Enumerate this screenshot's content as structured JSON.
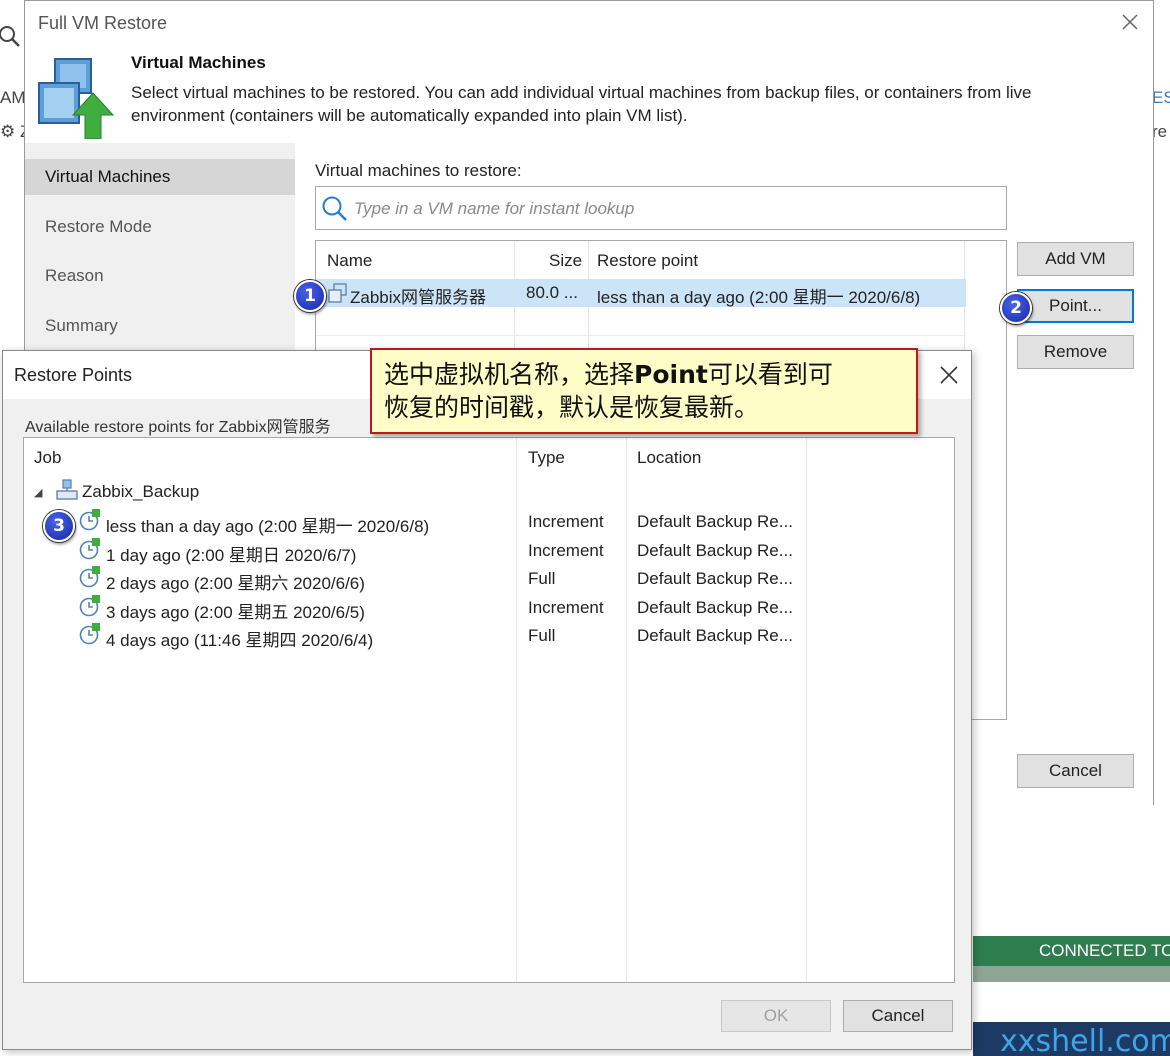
{
  "background": {
    "left_fragment_1": "AM",
    "left_fragment_2": "Z",
    "right_fragment_1": "ES",
    "right_fragment_2": "re",
    "status_text": "CONNECTED TO",
    "watermark": "xxshell.com"
  },
  "wizard": {
    "title": "Full VM Restore",
    "header_title": "Virtual Machines",
    "header_desc": "Select virtual machines to be restored. You can add individual virtual machines from backup files, or containers from live environment (containers will be automatically expanded into plain VM list).",
    "nav": [
      "Virtual Machines",
      "Restore Mode",
      "Reason",
      "Summary"
    ],
    "vm_label": "Virtual machines to restore:",
    "search_placeholder": "Type in a VM name for instant lookup",
    "columns": {
      "name": "Name",
      "size": "Size",
      "restore_point": "Restore point"
    },
    "vm_row": {
      "name": "Zabbix网管服务器",
      "size": "80.0 ...",
      "restore_point": "less than a day ago (2:00 星期一 2020/6/8)"
    },
    "buttons": {
      "add_vm": "Add VM",
      "point": "Point...",
      "remove": "Remove",
      "cancel": "Cancel"
    }
  },
  "restore_points": {
    "title": "Restore Points",
    "available_label": "Available restore points for Zabbix网管服务",
    "columns": {
      "job": "Job",
      "type": "Type",
      "location": "Location"
    },
    "job_name": "Zabbix_Backup",
    "rows": [
      {
        "point": "less than a day ago (2:00 星期一 2020/6/8)",
        "type": "Increment",
        "location": "Default Backup Re..."
      },
      {
        "point": "1 day ago (2:00 星期日 2020/6/7)",
        "type": "Increment",
        "location": "Default Backup Re..."
      },
      {
        "point": "2 days ago (2:00 星期六 2020/6/6)",
        "type": "Full",
        "location": "Default Backup Re..."
      },
      {
        "point": "3 days ago (2:00 星期五 2020/6/5)",
        "type": "Increment",
        "location": "Default Backup Re..."
      },
      {
        "point": "4 days ago (11:46 星期四 2020/6/4)",
        "type": "Full",
        "location": "Default Backup Re..."
      }
    ],
    "buttons": {
      "ok": "OK",
      "cancel": "Cancel"
    }
  },
  "callout": {
    "line1_prefix": "选中虚拟机名称，选择",
    "line1_bold": "Point",
    "line1_suffix": "可以看到可",
    "line2": "恢复的时间戳，默认是恢复最新。"
  },
  "badges": [
    "1",
    "2",
    "3"
  ],
  "colors": {
    "selection": "#cce4f7",
    "callout_bg": "#fdfdc8",
    "callout_border": "#c01818",
    "badge": "#1f35c4",
    "status_green": "#2e7d4f"
  }
}
